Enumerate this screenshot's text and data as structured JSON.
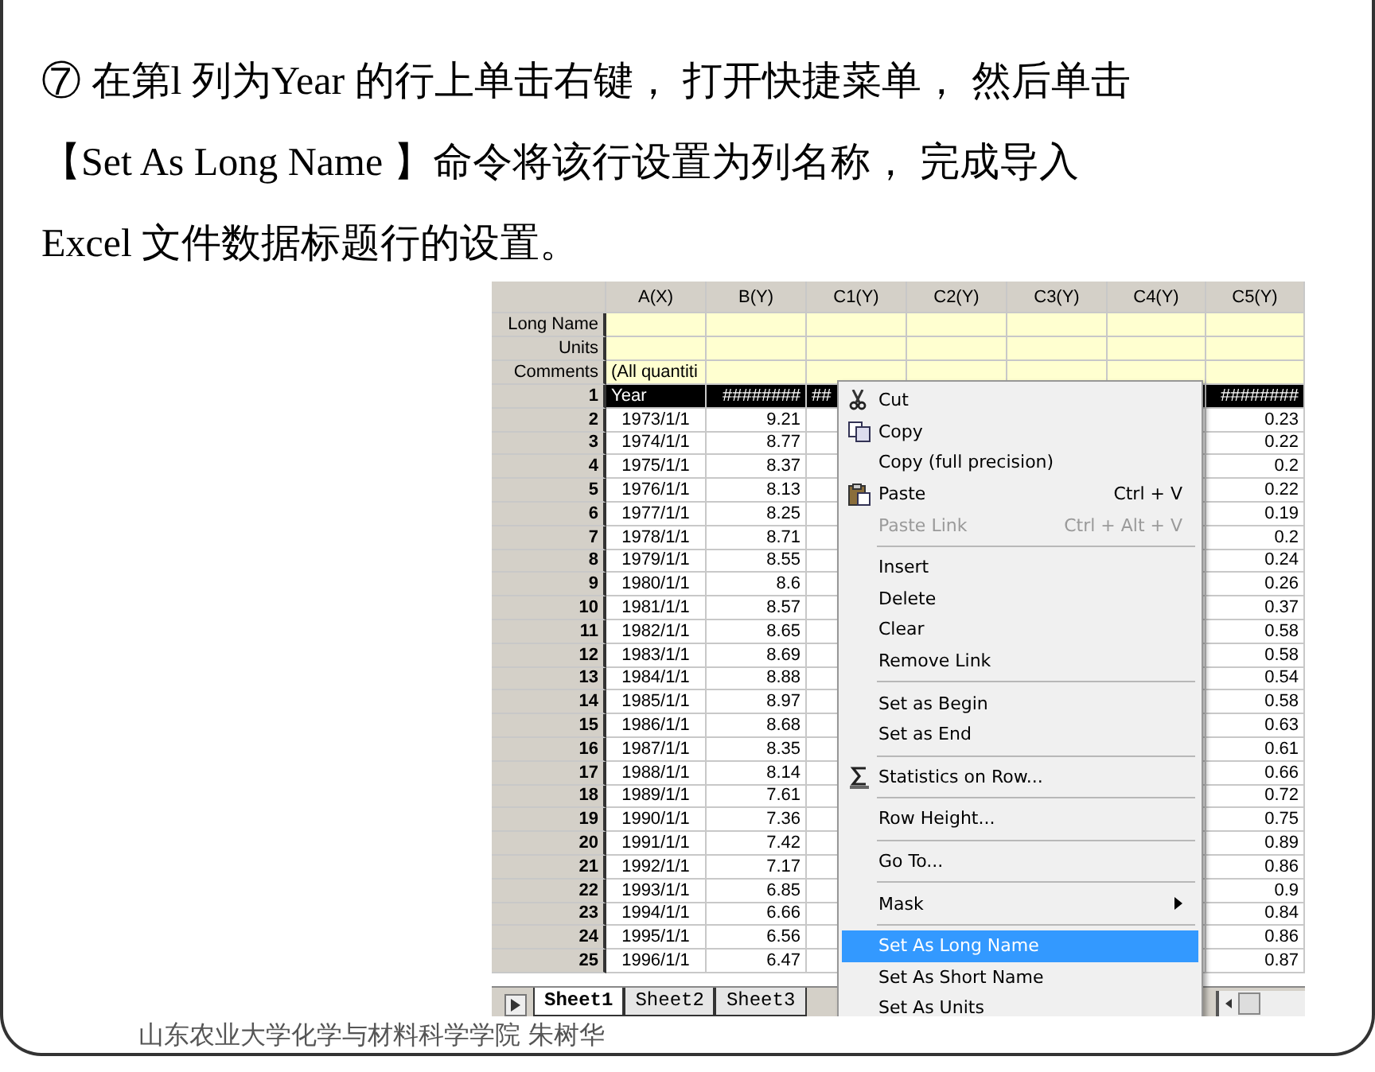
{
  "slide": {
    "instruction_lines": [
      "⑦ 在第l 列为Year 的行上单击右键， 打开快捷菜单， 然后单击",
      "【Set As Long Name 】命令将该行设置为列名称， 完成导入",
      "Excel 文件数据标题行的设置。"
    ],
    "footer": "山东农业大学化学与材料科学学院 朱树华"
  },
  "sheet": {
    "columns": [
      "A(X)",
      "B(Y)",
      "C1(Y)",
      "C2(Y)",
      "C3(Y)",
      "C4(Y)",
      "C5(Y)"
    ],
    "label_rows": [
      {
        "label": "Long Name"
      },
      {
        "label": "Units"
      },
      {
        "label": "Comments",
        "first_cell": "(All quantiti"
      }
    ],
    "rows": [
      {
        "number": "1",
        "selected": true,
        "a": "Year",
        "b": "########",
        "c1": "##",
        "c5": "########"
      },
      {
        "number": "2",
        "selected": false,
        "a": "1973/1/1",
        "b": "9.21",
        "c5": "0.23"
      },
      {
        "number": "3",
        "selected": false,
        "a": "1974/1/1",
        "b": "8.77",
        "c5": "0.22"
      },
      {
        "number": "4",
        "selected": false,
        "a": "1975/1/1",
        "b": "8.37",
        "c5": "0.2"
      },
      {
        "number": "5",
        "selected": false,
        "a": "1976/1/1",
        "b": "8.13",
        "c5": "0.22"
      },
      {
        "number": "6",
        "selected": false,
        "a": "1977/1/1",
        "b": "8.25",
        "c5": "0.19"
      },
      {
        "number": "7",
        "selected": false,
        "a": "1978/1/1",
        "b": "8.71",
        "c5": "0.2"
      },
      {
        "number": "8",
        "selected": false,
        "a": "1979/1/1",
        "b": "8.55",
        "c5": "0.24"
      },
      {
        "number": "9",
        "selected": false,
        "a": "1980/1/1",
        "b": "8.6",
        "c5": "0.26"
      },
      {
        "number": "10",
        "selected": false,
        "a": "1981/1/1",
        "b": "8.57",
        "c5": "0.37"
      },
      {
        "number": "11",
        "selected": false,
        "a": "1982/1/1",
        "b": "8.65",
        "c5": "0.58"
      },
      {
        "number": "12",
        "selected": false,
        "a": "1983/1/1",
        "b": "8.69",
        "c5": "0.58"
      },
      {
        "number": "13",
        "selected": false,
        "a": "1984/1/1",
        "b": "8.88",
        "c5": "0.54"
      },
      {
        "number": "14",
        "selected": false,
        "a": "1985/1/1",
        "b": "8.97",
        "c5": "0.58"
      },
      {
        "number": "15",
        "selected": false,
        "a": "1986/1/1",
        "b": "8.68",
        "c5": "0.63"
      },
      {
        "number": "16",
        "selected": false,
        "a": "1987/1/1",
        "b": "8.35",
        "c5": "0.61"
      },
      {
        "number": "17",
        "selected": false,
        "a": "1988/1/1",
        "b": "8.14",
        "c5": "0.66"
      },
      {
        "number": "18",
        "selected": false,
        "a": "1989/1/1",
        "b": "7.61",
        "c5": "0.72"
      },
      {
        "number": "19",
        "selected": false,
        "a": "1990/1/1",
        "b": "7.36",
        "c5": "0.75"
      },
      {
        "number": "20",
        "selected": false,
        "a": "1991/1/1",
        "b": "7.42",
        "c5": "0.89"
      },
      {
        "number": "21",
        "selected": false,
        "a": "1992/1/1",
        "b": "7.17",
        "c5": "0.86"
      },
      {
        "number": "22",
        "selected": false,
        "a": "1993/1/1",
        "b": "6.85",
        "c5": "0.9"
      },
      {
        "number": "23",
        "selected": false,
        "a": "1994/1/1",
        "b": "6.66",
        "c5": "0.84"
      },
      {
        "number": "24",
        "selected": false,
        "a": "1995/1/1",
        "b": "6.56",
        "c5": "0.86"
      },
      {
        "number": "25",
        "selected": false,
        "a": "1996/1/1",
        "b": "6.47",
        "c5": "0.87"
      }
    ],
    "tabs": [
      {
        "label": "Sheet1",
        "selected": true
      },
      {
        "label": "Sheet2",
        "selected": false
      },
      {
        "label": "Sheet3",
        "selected": false
      }
    ]
  },
  "context_menu": [
    {
      "kind": "item",
      "label": "Cut",
      "disabled": false,
      "selected": false
    },
    {
      "kind": "item",
      "label": "Copy",
      "disabled": false,
      "selected": false
    },
    {
      "kind": "item",
      "label": "Copy (full precision)",
      "disabled": false,
      "selected": false
    },
    {
      "kind": "item",
      "label": "Paste",
      "shortcut": "Ctrl + V",
      "disabled": false,
      "selected": false
    },
    {
      "kind": "item",
      "label": "Paste Link",
      "shortcut": "Ctrl + Alt + V",
      "disabled": true,
      "selected": false
    },
    {
      "kind": "separator"
    },
    {
      "kind": "item",
      "label": "Insert",
      "disabled": false,
      "selected": false
    },
    {
      "kind": "item",
      "label": "Delete",
      "disabled": false,
      "selected": false
    },
    {
      "kind": "item",
      "label": "Clear",
      "disabled": false,
      "selected": false
    },
    {
      "kind": "item",
      "label": "Remove Link",
      "disabled": false,
      "selected": false
    },
    {
      "kind": "separator"
    },
    {
      "kind": "item",
      "label": "Set as Begin",
      "disabled": false,
      "selected": false
    },
    {
      "kind": "item",
      "label": "Set as End",
      "disabled": false,
      "selected": false
    },
    {
      "kind": "separator"
    },
    {
      "kind": "item",
      "label": "Statistics on Row...",
      "disabled": false,
      "selected": false
    },
    {
      "kind": "separator"
    },
    {
      "kind": "item",
      "label": "Row Height...",
      "disabled": false,
      "selected": false
    },
    {
      "kind": "separator"
    },
    {
      "kind": "item",
      "label": "Go To...",
      "disabled": false,
      "selected": false
    },
    {
      "kind": "separator"
    },
    {
      "kind": "item",
      "label": "Mask",
      "submenu": true,
      "disabled": false,
      "selected": false
    },
    {
      "kind": "separator"
    },
    {
      "kind": "item",
      "label": "Set As Long Name",
      "disabled": false,
      "selected": true
    },
    {
      "kind": "item",
      "label": "Set As Short Name",
      "disabled": false,
      "selected": false
    },
    {
      "kind": "item",
      "label": "Set As Units",
      "disabled": false,
      "selected": false
    }
  ]
}
